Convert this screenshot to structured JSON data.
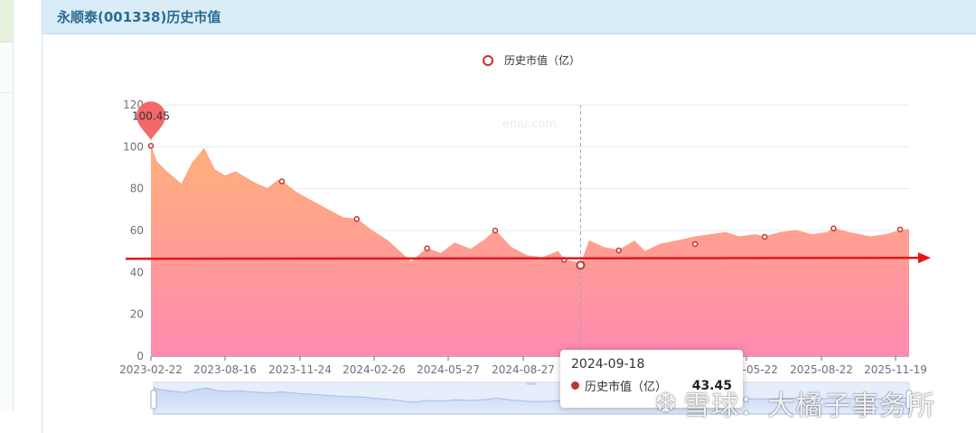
{
  "page_title": "永顺泰(001338)历史市值",
  "chart_data": {
    "type": "area",
    "legend": {
      "label": "历史市值（亿）",
      "placement": "top-center"
    },
    "site_watermark": "eniu.com",
    "ylim": [
      0,
      120
    ],
    "y_ticks": [
      0,
      20,
      40,
      60,
      80,
      100,
      120
    ],
    "x_tick_labels": [
      "2023-02-22",
      "2023-08-16",
      "2023-11-24",
      "2024-02-26",
      "2024-05-27",
      "2024-08-27",
      "2025-05-22",
      "2025-08-22",
      "2025-11-19"
    ],
    "grid": true,
    "series": [
      {
        "x": [
          "2023-02-22",
          "2023-03-01",
          "2023-03-15",
          "2023-04-04",
          "2023-04-18",
          "2023-05-04",
          "2023-05-18",
          "2023-06-01",
          "2023-06-15",
          "2023-06-29",
          "2023-07-14",
          "2023-07-28",
          "2023-08-11",
          "2023-08-16",
          "2023-09-05",
          "2023-09-25",
          "2023-10-16",
          "2023-11-06",
          "2023-11-24",
          "2023-12-14",
          "2024-01-05",
          "2024-01-23",
          "2024-02-05",
          "2024-02-26",
          "2024-03-15",
          "2024-04-03",
          "2024-04-24",
          "2024-05-15",
          "2024-05-27",
          "2024-06-17",
          "2024-07-08",
          "2024-07-29",
          "2024-08-19",
          "2024-08-27",
          "2024-09-10",
          "2024-09-18",
          "2024-09-30",
          "2024-10-18",
          "2024-11-08",
          "2024-11-29",
          "2024-12-13",
          "2025-01-03",
          "2025-01-24",
          "2025-02-18",
          "2025-03-10",
          "2025-03-31",
          "2025-04-18",
          "2025-05-09",
          "2025-05-22",
          "2025-06-12",
          "2025-07-03",
          "2025-07-24",
          "2025-08-14",
          "2025-08-22",
          "2025-09-12",
          "2025-10-10",
          "2025-10-31",
          "2025-11-19",
          "2025-12-01"
        ],
        "values": [
          100.45,
          93,
          88,
          82,
          92,
          99,
          89,
          86,
          88,
          85,
          82,
          80,
          84,
          83.45,
          78,
          74,
          70,
          66,
          65.5,
          60,
          55,
          49,
          45,
          51.5,
          49,
          54,
          51,
          56,
          60,
          52,
          48,
          47,
          50,
          46,
          45,
          43.45,
          55,
          52,
          50.5,
          55,
          50,
          53.5,
          55,
          57,
          58,
          59,
          57,
          58,
          57,
          59,
          60,
          58,
          59,
          61,
          59,
          57,
          58,
          60,
          60.5
        ]
      }
    ],
    "marked_points": [
      {
        "x": "2023-02-22",
        "y": 100.45,
        "label": "100.45"
      },
      {
        "x": "2023-08-16",
        "y": 83.45
      },
      {
        "x": "2023-11-24",
        "y": 65.5
      },
      {
        "x": "2024-02-26",
        "y": 51.5
      },
      {
        "x": "2024-05-27",
        "y": 60
      },
      {
        "x": "2024-08-27",
        "y": 46
      },
      {
        "x": "2024-09-18",
        "y": 43.45
      },
      {
        "x": "2024-11-08",
        "y": 50.5
      },
      {
        "x": "2025-02-18",
        "y": 53.5
      },
      {
        "x": "2025-05-22",
        "y": 57
      },
      {
        "x": "2025-08-22",
        "y": 61
      },
      {
        "x": "2025-11-19",
        "y": 60.5
      }
    ],
    "hover_x": "2024-09-18",
    "reference_line_y": 46.5,
    "colors": {
      "area_top": "#ffb07a",
      "area_bottom": "#ff8ab0",
      "marker": "#c23531",
      "pin": "#f46868",
      "reference_line": "#e8151b",
      "grid": "#e6eaf0"
    }
  },
  "tooltip": {
    "date": "2024-09-18",
    "series_label": "历史市值（亿）",
    "value": "43.45"
  },
  "watermark": {
    "logo": "❆",
    "text": "雪球：大橘子事务所"
  }
}
